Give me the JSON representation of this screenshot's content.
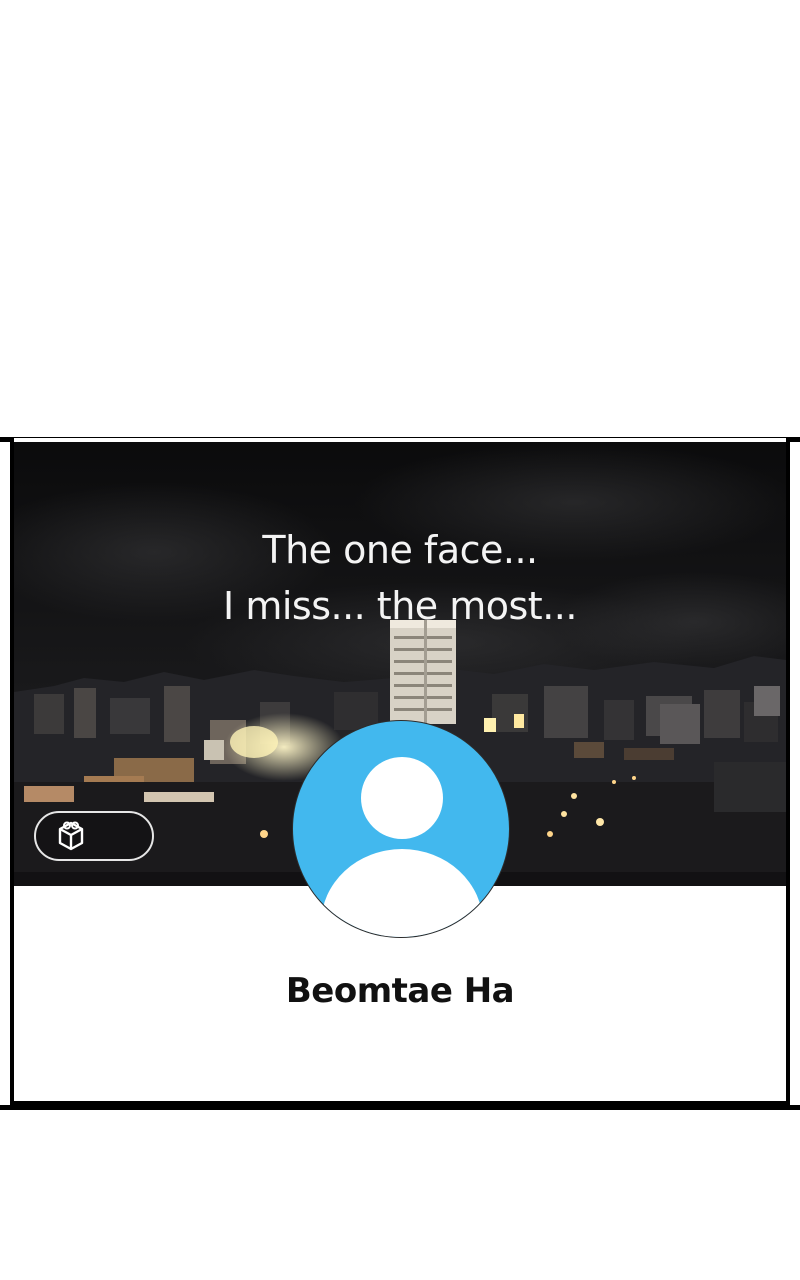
{
  "cover": {
    "caption_line_1": "The one face...",
    "caption_line_2": "I miss... the most..."
  },
  "gift_button": {
    "icon": "gift-icon",
    "label": ""
  },
  "profile": {
    "avatar_icon": "default-user-avatar",
    "avatar_color": "#42b8ee",
    "name": "Beomtae Ha"
  }
}
